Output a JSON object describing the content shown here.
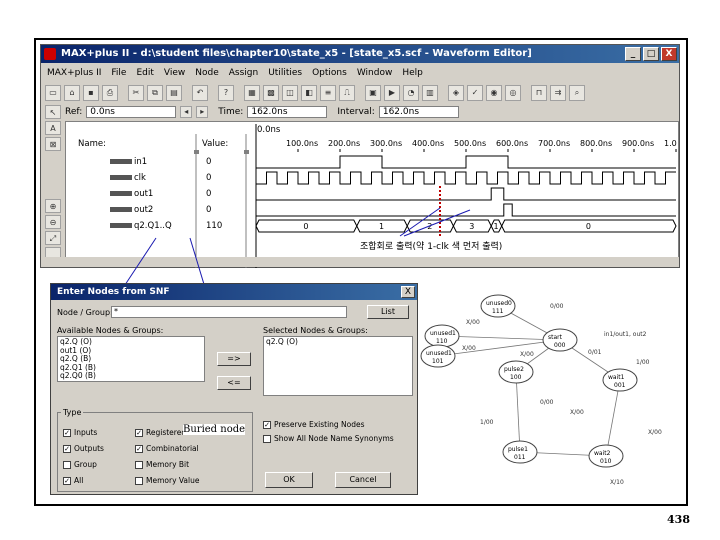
{
  "window": {
    "title": "MAX+plus II - d:\\student files\\chapter10\\state_x5 - [state_x5.scf - Waveform Editor]",
    "controls": [
      "_",
      "□",
      "X"
    ]
  },
  "menu": [
    "MAX+plus II",
    "File",
    "Edit",
    "View",
    "Node",
    "Assign",
    "Utilities",
    "Options",
    "Window",
    "Help"
  ],
  "toolbar": {
    "ref_label": "Ref:",
    "ref_value": "0.0ns",
    "time_label": "Time:",
    "time_value": "162.0ns",
    "interval_label": "Interval:",
    "interval_value": "162.0ns",
    "cursor_label": "0.0ns"
  },
  "waveform": {
    "name_header": "Name:",
    "value_header": "Value:",
    "time_ticks": [
      "100.0ns",
      "200.0ns",
      "300.0ns",
      "400.0ns",
      "500.0ns",
      "600.0ns",
      "700.0ns",
      "800.0ns",
      "900.0ns",
      "1.0"
    ],
    "signals": [
      {
        "name": "in1",
        "value": "0"
      },
      {
        "name": "clk",
        "value": "0"
      },
      {
        "name": "out1",
        "value": "0"
      },
      {
        "name": "out2",
        "value": "0"
      },
      {
        "name": "q2.Q1..Q",
        "value": "110"
      }
    ],
    "bus_values": [
      "0",
      "1",
      "2",
      "3",
      "1",
      "0"
    ]
  },
  "annotation_korean": "조합회로 출력(약 1-clk 색 먼저 출력)",
  "buried_node_label": "Buried  node",
  "dialog": {
    "title": "Enter Nodes from SNF",
    "close": "X",
    "node_group_label": "Node / Group:",
    "node_group_value": "*",
    "list_button": "List",
    "available_label": "Available Nodes & Groups:",
    "selected_label": "Selected Nodes & Groups:",
    "available_items": [
      "q2.Q (O)",
      "out1 (O)",
      "q2.Q (B)",
      "q2.Q1 (B)",
      "q2.Q0 (B)",
      "q2.Q1 (B)"
    ],
    "selected_items": [
      "q2.Q (O)"
    ],
    "arrow_right": "=>",
    "arrow_left": "<=",
    "type_label": "Type",
    "types_left": [
      {
        "label": "Inputs",
        "checked": true
      },
      {
        "label": "Outputs",
        "checked": true
      },
      {
        "label": "Group",
        "checked": false
      },
      {
        "label": "All",
        "checked": true
      }
    ],
    "types_right": [
      {
        "label": "Registered",
        "checked": true
      },
      {
        "label": "Combinatorial",
        "checked": true
      },
      {
        "label": "Memory Bit",
        "checked": false
      },
      {
        "label": "Memory Value",
        "checked": false
      }
    ],
    "preserve_label": "Preserve Existing Nodes",
    "show_all_label": "Show All Node Name Synonyms",
    "ok": "OK",
    "cancel": "Cancel"
  },
  "state_diagram": {
    "states": [
      {
        "name": "unused0",
        "code": "111"
      },
      {
        "name": "unused1",
        "code": "110"
      },
      {
        "name": "unused1",
        "code": "101"
      },
      {
        "name": "start",
        "code": "000"
      },
      {
        "name": "pulse2",
        "code": "100"
      },
      {
        "name": "wait1",
        "code": "001"
      },
      {
        "name": "pulse1",
        "code": "011"
      },
      {
        "name": "wait2",
        "code": "010"
      }
    ],
    "edge_labels": [
      "0/00",
      "X/00",
      "X/00",
      "X/00",
      "0/01",
      "1/00",
      "X/00",
      "X/10",
      "1/00",
      "0/00",
      "X/00"
    ],
    "legend": "in1/out1, out2"
  },
  "page_number": "438"
}
